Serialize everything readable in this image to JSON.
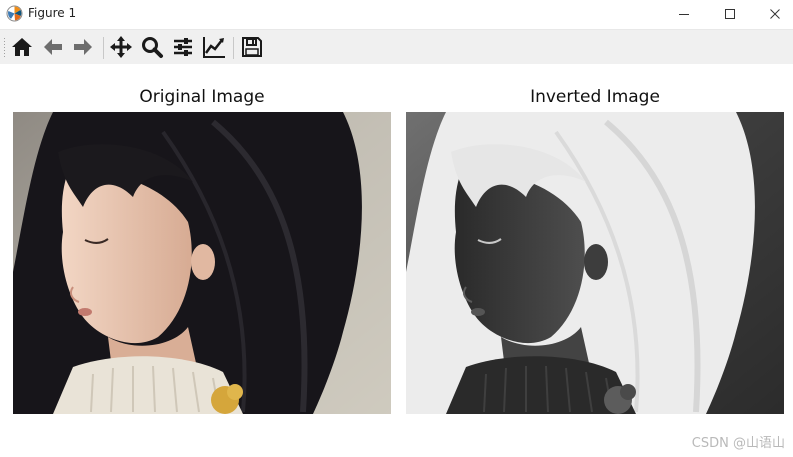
{
  "window": {
    "title": "Figure 1",
    "controls": [
      "minimize",
      "maximize",
      "close"
    ]
  },
  "toolbar": {
    "tools": [
      {
        "name": "home-icon",
        "tooltip": "Home"
      },
      {
        "name": "back-arrow-icon",
        "tooltip": "Back"
      },
      {
        "name": "forward-arrow-icon",
        "tooltip": "Forward"
      },
      {
        "name": "pan-icon",
        "tooltip": "Pan"
      },
      {
        "name": "zoom-icon",
        "tooltip": "Zoom"
      },
      {
        "name": "configure-subplots-icon",
        "tooltip": "Configure subplots"
      },
      {
        "name": "edit-axis-icon",
        "tooltip": "Edit axis"
      },
      {
        "name": "save-icon",
        "tooltip": "Save"
      }
    ]
  },
  "figure": {
    "subplots": [
      {
        "title": "Original Image",
        "image": "portrait-original"
      },
      {
        "title": "Inverted Image",
        "image": "portrait-inverted"
      }
    ]
  },
  "watermark": "CSDN @山语山",
  "colors": {
    "toolbar_bg": "#f0f0f0",
    "icon_dark": "#1a1a1a",
    "icon_gray": "#6d6d6d",
    "watermark": "#b9b9b9"
  }
}
